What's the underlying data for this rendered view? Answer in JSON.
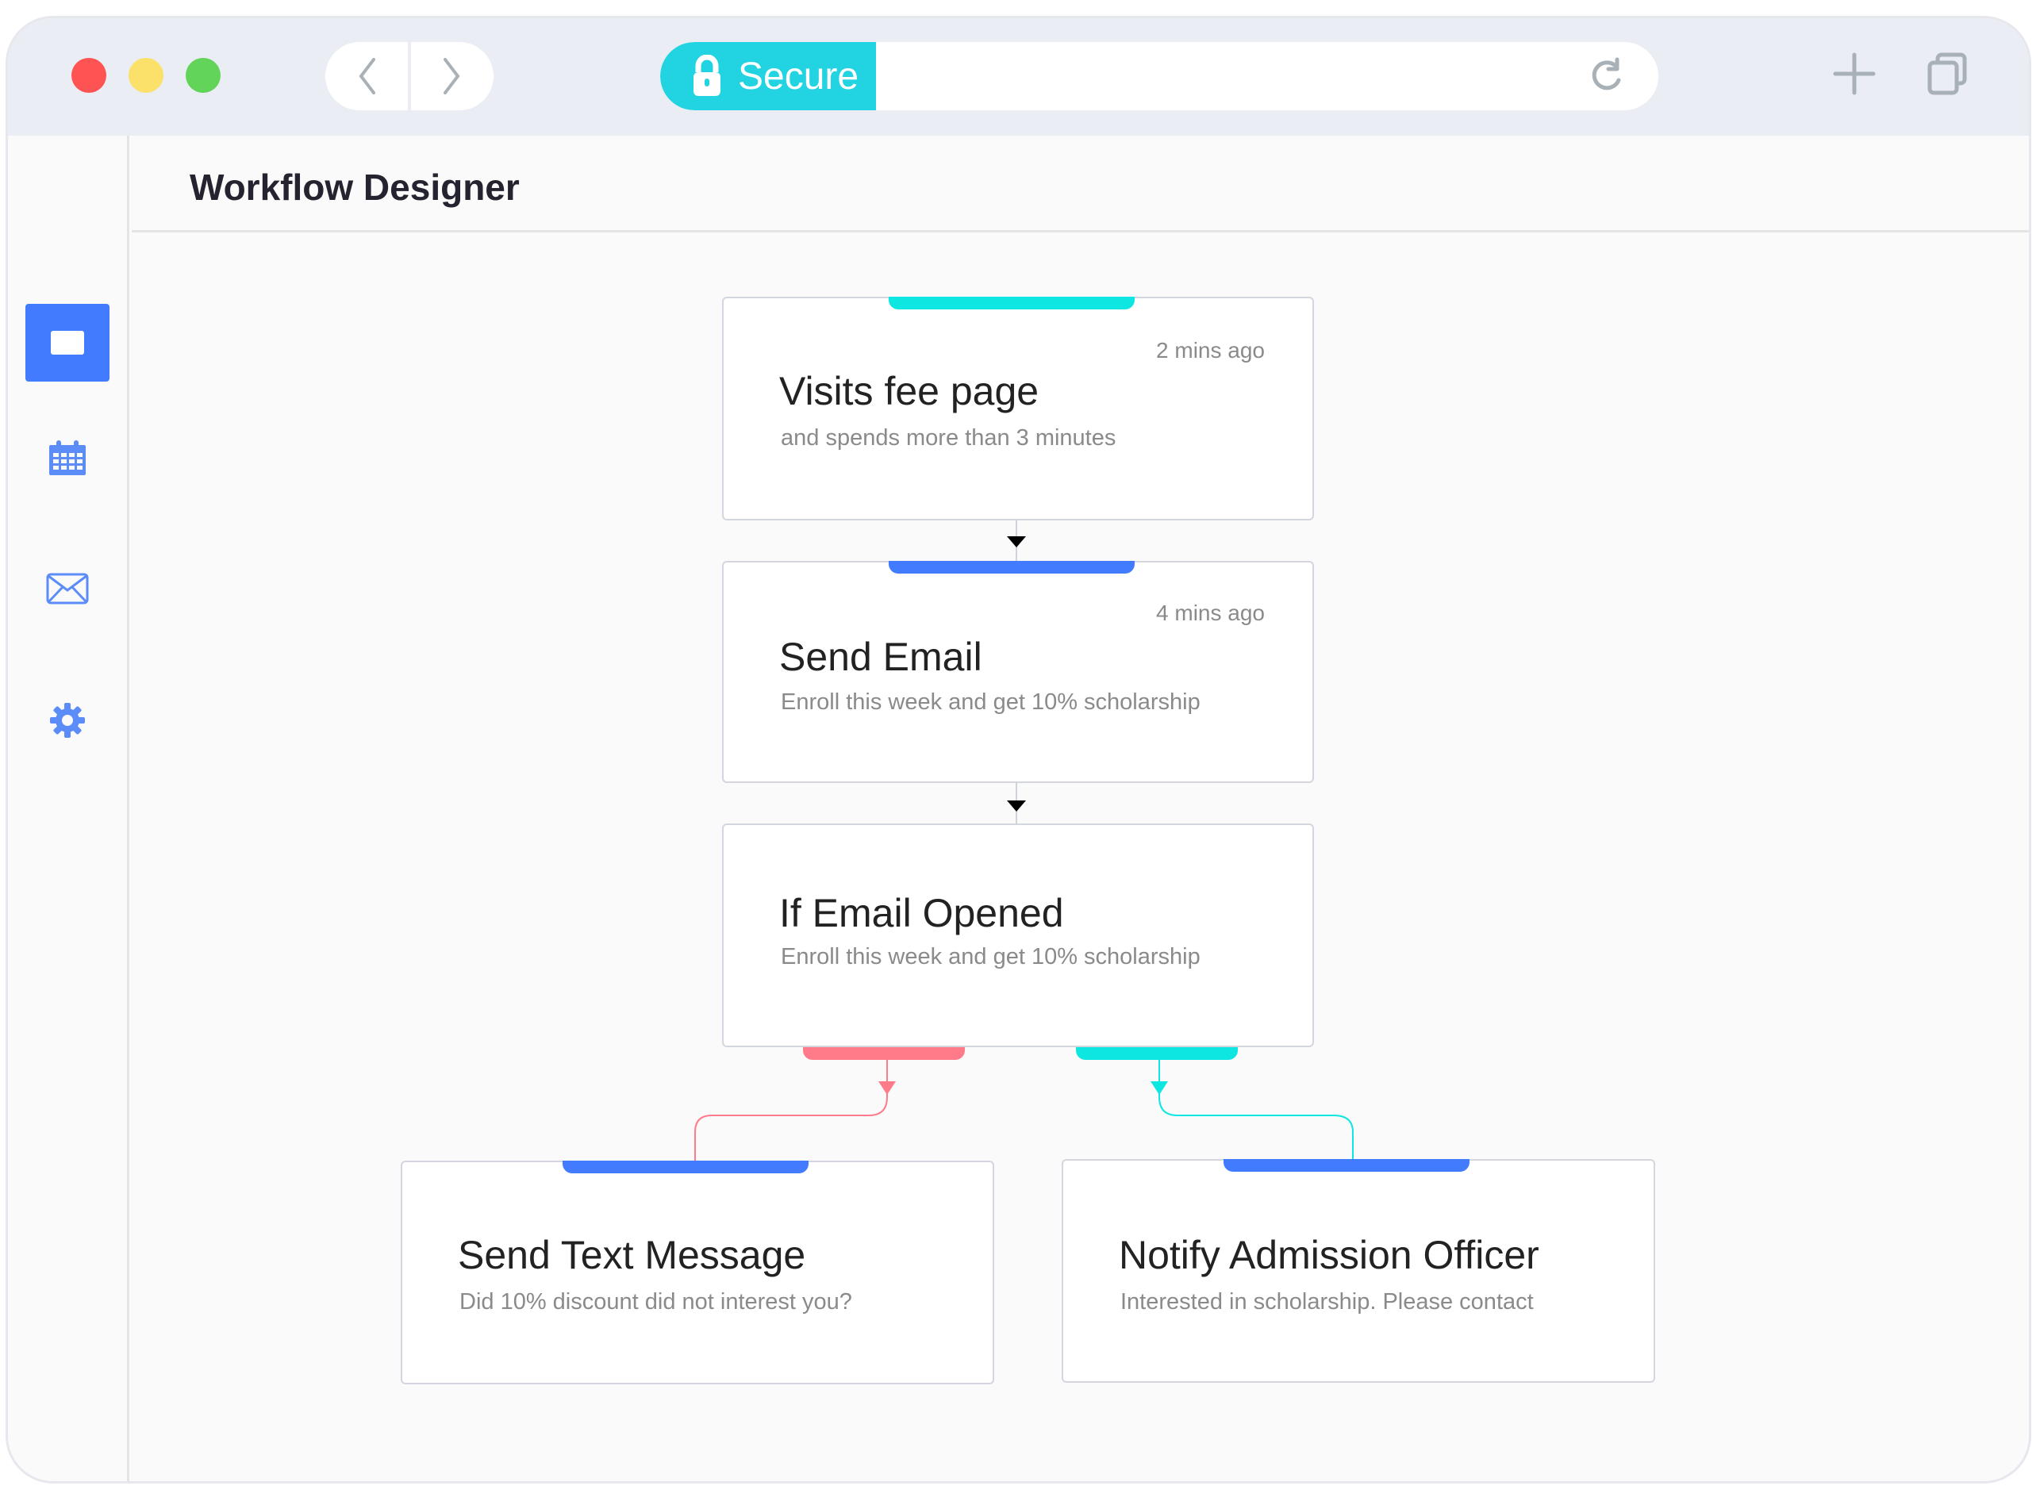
{
  "browser": {
    "secure_label": "Secure",
    "icons": {
      "back": "chevron-left-icon",
      "forward": "chevron-right-icon",
      "lock": "lock-icon",
      "reload": "reload-icon",
      "new_tab": "plus-icon",
      "tabs": "tabs-icon"
    }
  },
  "sidebar": {
    "items": [
      {
        "name": "dashboard",
        "icon": "square-icon",
        "active": true
      },
      {
        "name": "calendar",
        "icon": "calendar-icon",
        "active": false
      },
      {
        "name": "mail",
        "icon": "mail-icon",
        "active": false
      },
      {
        "name": "settings",
        "icon": "gear-icon",
        "active": false
      }
    ]
  },
  "header": {
    "title": "Workflow Designer"
  },
  "workflow": {
    "nodes": [
      {
        "title": "Visits fee page",
        "subtitle": "and spends more than 3 minutes",
        "time": "2 mins ago",
        "accent": "#0ee6e2"
      },
      {
        "title": "Send Email",
        "subtitle": "Enroll this week and get 10% scholarship",
        "time": "4 mins ago",
        "accent": "#427bfd"
      },
      {
        "title": "If Email Opened",
        "subtitle": "Enroll this week and get 10% scholarship",
        "time": "",
        "accent": ""
      },
      {
        "title": "Send Text Message",
        "subtitle": "Did 10% discount did not interest you?",
        "time": "",
        "accent": "#427bfd"
      },
      {
        "title": "Notify Admission Officer",
        "subtitle": "Interested in scholarship. Please contact",
        "time": "",
        "accent": "#427bfd"
      }
    ],
    "branches": {
      "no_color": "#ff7b8a",
      "yes_color": "#0ee6e2"
    }
  }
}
